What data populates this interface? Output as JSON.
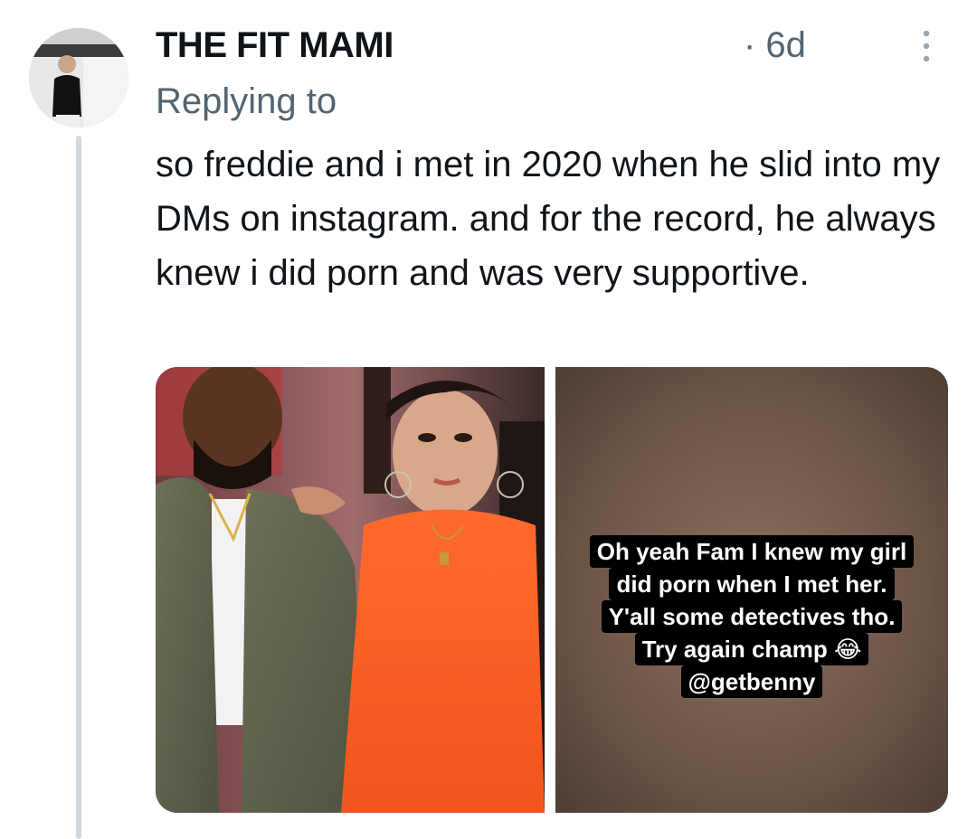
{
  "tweet": {
    "author_name": "THE FIT MAMI",
    "timestamp": "· 6d",
    "reply_label": "Replying to",
    "text": "so freddie and i met in 2020 when he slid into my DMs on instagram. and for the record, he always knew i did porn and was very supportive.",
    "more_icon": "more-dots-icon"
  },
  "media": {
    "left_photo": "couple-photo",
    "right_story": {
      "caption_lines": [
        "Oh yeah Fam I knew my girl",
        "did porn when I met her.",
        "Y'all some detectives tho.",
        "Try again champ 😂",
        "@getbenny"
      ]
    }
  },
  "colors": {
    "primary_text": "#0f1419",
    "secondary_text": "#536471",
    "thread_line": "#cfd9de"
  }
}
